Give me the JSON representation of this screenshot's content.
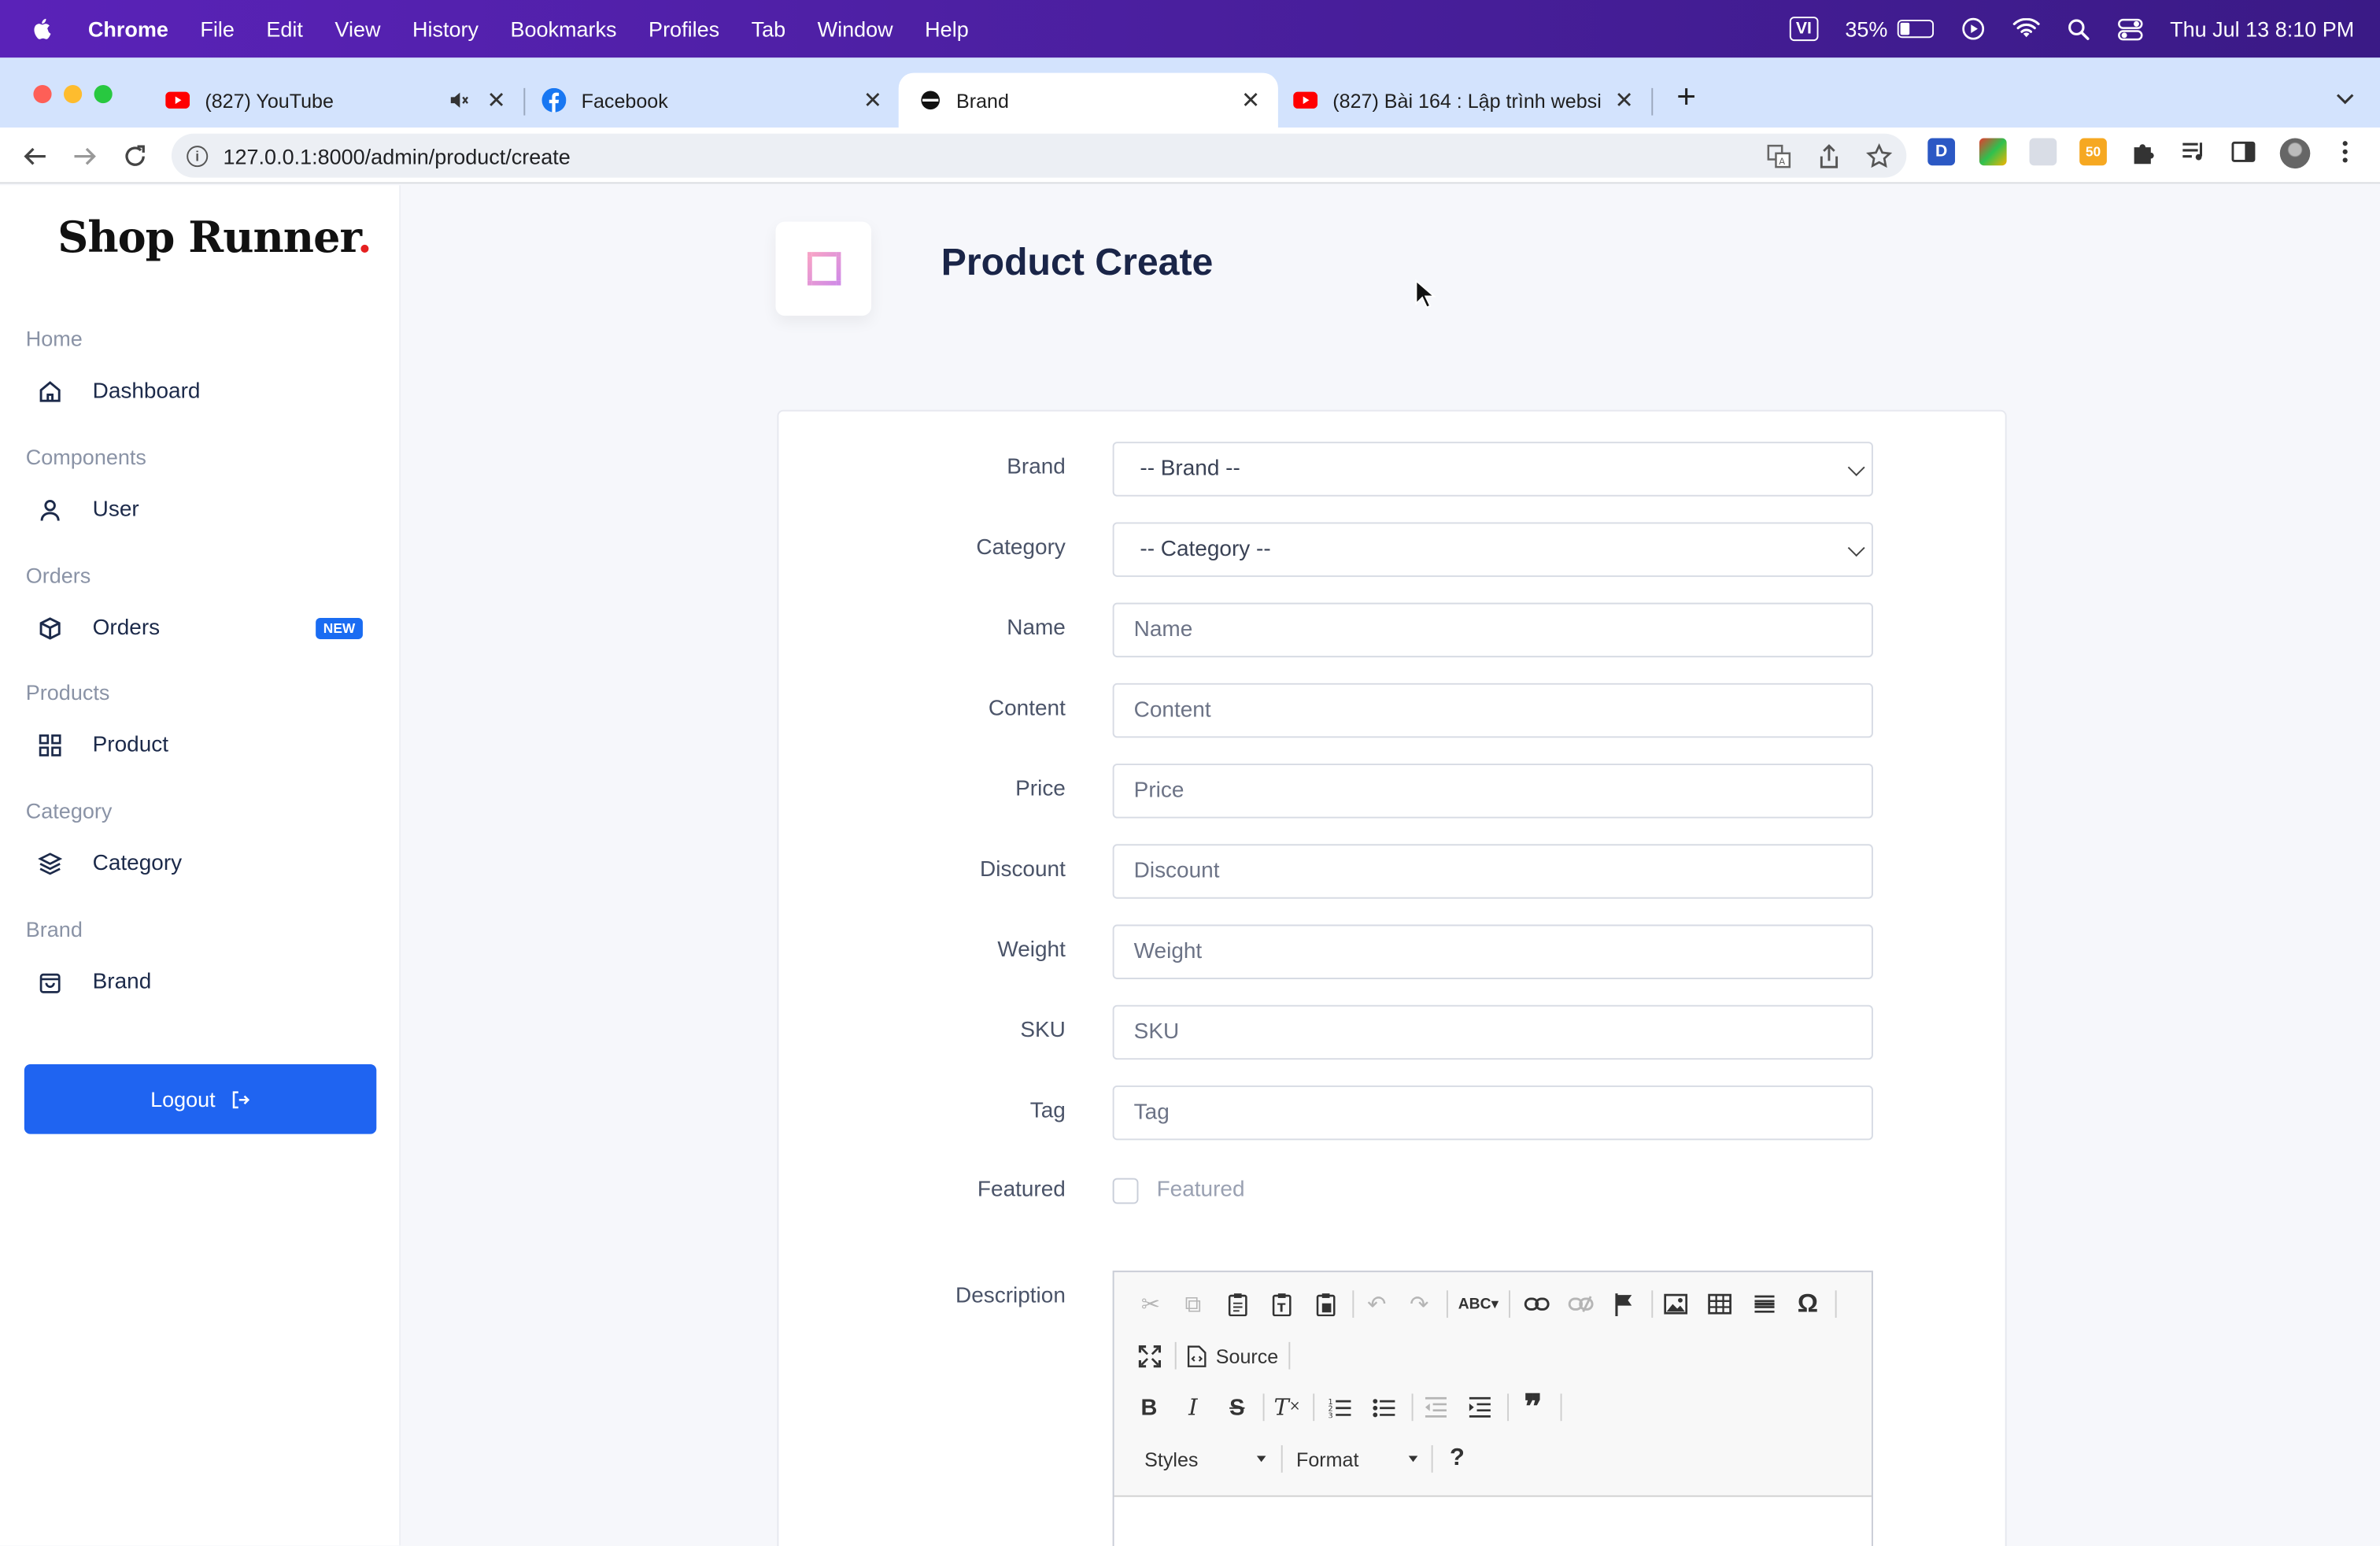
{
  "menubar": {
    "app": "Chrome",
    "items": [
      "File",
      "Edit",
      "View",
      "History",
      "Bookmarks",
      "Profiles",
      "Tab",
      "Window",
      "Help"
    ],
    "input_source": "VI",
    "battery_text": "35%",
    "battery_level": 0.35,
    "datetime": "Thu Jul 13  8:10 PM"
  },
  "tabs": [
    {
      "title": "(827) YouTube",
      "icon": "youtube-icon",
      "muted": true
    },
    {
      "title": "Facebook",
      "icon": "facebook-icon"
    },
    {
      "title": "Brand",
      "icon": "site-icon",
      "active": true
    },
    {
      "title": "(827) Bài 164 : Lập trình websi",
      "icon": "youtube-icon"
    }
  ],
  "toolbar": {
    "url": "127.0.0.1:8000/admin/product/create"
  },
  "sidebar": {
    "logo_main": "Shop Runner",
    "logo_dot": ".",
    "sections": [
      {
        "title": "Home",
        "item": "Dashboard",
        "icon": "home-icon"
      },
      {
        "title": "Components",
        "item": "User",
        "icon": "user-icon"
      },
      {
        "title": "Orders",
        "item": "Orders",
        "icon": "box-icon",
        "badge": "NEW"
      },
      {
        "title": "Products",
        "item": "Product",
        "icon": "grid-icon"
      },
      {
        "title": "Category",
        "item": "Category",
        "icon": "layers-icon"
      },
      {
        "title": "Brand",
        "item": "Brand",
        "icon": "bag-icon"
      }
    ],
    "logout_label": "Logout"
  },
  "page": {
    "title": "Product Create"
  },
  "form": {
    "brand": {
      "label": "Brand",
      "selected": "-- Brand --"
    },
    "category": {
      "label": "Category",
      "selected": "-- Category --"
    },
    "fields": [
      {
        "label": "Name",
        "placeholder": "Name"
      },
      {
        "label": "Content",
        "placeholder": "Content"
      },
      {
        "label": "Price",
        "placeholder": "Price"
      },
      {
        "label": "Discount",
        "placeholder": "Discount"
      },
      {
        "label": "Weight",
        "placeholder": "Weight"
      },
      {
        "label": "SKU",
        "placeholder": "SKU"
      },
      {
        "label": "Tag",
        "placeholder": "Tag"
      }
    ],
    "featured": {
      "label": "Featured",
      "checkbox_label": "Featured",
      "checked": false
    },
    "description": {
      "label": "Description",
      "source_label": "Source",
      "styles_label": "Styles",
      "format_label": "Format",
      "help_label": "?"
    }
  },
  "colors": {
    "primary": "#1f64f1",
    "menubar": "#4b1fa0",
    "title": "#1a2548"
  }
}
